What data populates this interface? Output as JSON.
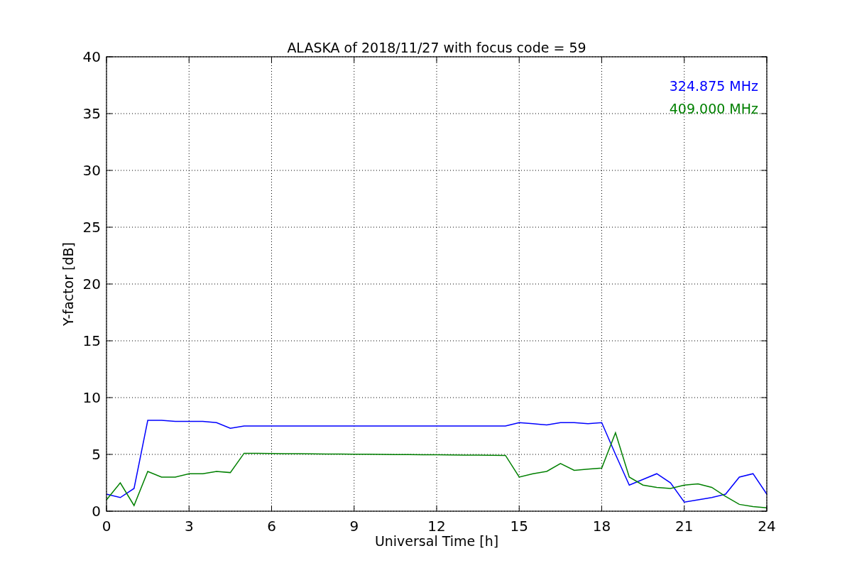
{
  "chart": {
    "chart_data": {
      "type": "line",
      "title": "ALASKA of 2018/11/27 with focus code = 59",
      "xlabel": "Universal Time [h]",
      "ylabel": "Y-factor [dB]",
      "x": [
        0,
        0.5,
        1,
        1.5,
        2,
        2.5,
        3,
        3.5,
        4,
        4.5,
        5,
        5.5,
        6,
        6.5,
        7,
        7.5,
        8,
        8.5,
        9,
        9.5,
        10,
        10.5,
        11,
        11.5,
        12,
        12.5,
        13,
        13.5,
        14,
        14.5,
        15,
        15.5,
        16,
        16.5,
        17,
        17.5,
        18,
        18.5,
        19,
        19.5,
        20,
        20.5,
        21,
        21.5,
        22,
        22.5,
        23,
        23.5,
        24
      ],
      "series": [
        {
          "name": "324.875 MHz",
          "color": "#0000ff",
          "values": [
            1.5,
            1.2,
            2,
            8,
            8,
            7.9,
            7.9,
            7.9,
            7.8,
            7.3,
            7.5,
            7.5,
            7.5,
            7.5,
            7.5,
            7.5,
            7.5,
            7.5,
            7.5,
            7.5,
            7.5,
            7.5,
            7.5,
            7.5,
            7.5,
            7.5,
            7.5,
            7.5,
            7.5,
            7.5,
            7.8,
            7.7,
            7.6,
            7.8,
            7.8,
            7.7,
            7.8,
            5,
            2.3,
            2.8,
            3.3,
            2.5,
            0.8,
            1,
            1.2,
            1.5,
            3,
            3.3,
            1.5
          ]
        },
        {
          "name": "409.000 MHz",
          "color": "#008000",
          "values": [
            1,
            2.5,
            0.5,
            3.5,
            3,
            3,
            3.3,
            3.3,
            3.5,
            3.4,
            5.1,
            5.09,
            5.08,
            5.07,
            5.06,
            5.05,
            5.04,
            5.03,
            5.02,
            5.01,
            5,
            4.99,
            4.98,
            4.97,
            4.96,
            4.95,
            4.94,
            4.93,
            4.92,
            4.91,
            3,
            3.3,
            3.5,
            4.2,
            3.6,
            3.7,
            3.8,
            6.9,
            3,
            2.3,
            2.1,
            2,
            2.3,
            2.4,
            2.1,
            1.3,
            0.6,
            0.4,
            0.3
          ]
        }
      ],
      "grid": true,
      "xlim": [
        0,
        24
      ],
      "ylim": [
        0,
        40
      ],
      "xticks": [
        0,
        3,
        6,
        9,
        12,
        15,
        18,
        21,
        24
      ],
      "yticks": [
        0,
        5,
        10,
        15,
        20,
        25,
        30,
        35,
        40
      ]
    }
  }
}
